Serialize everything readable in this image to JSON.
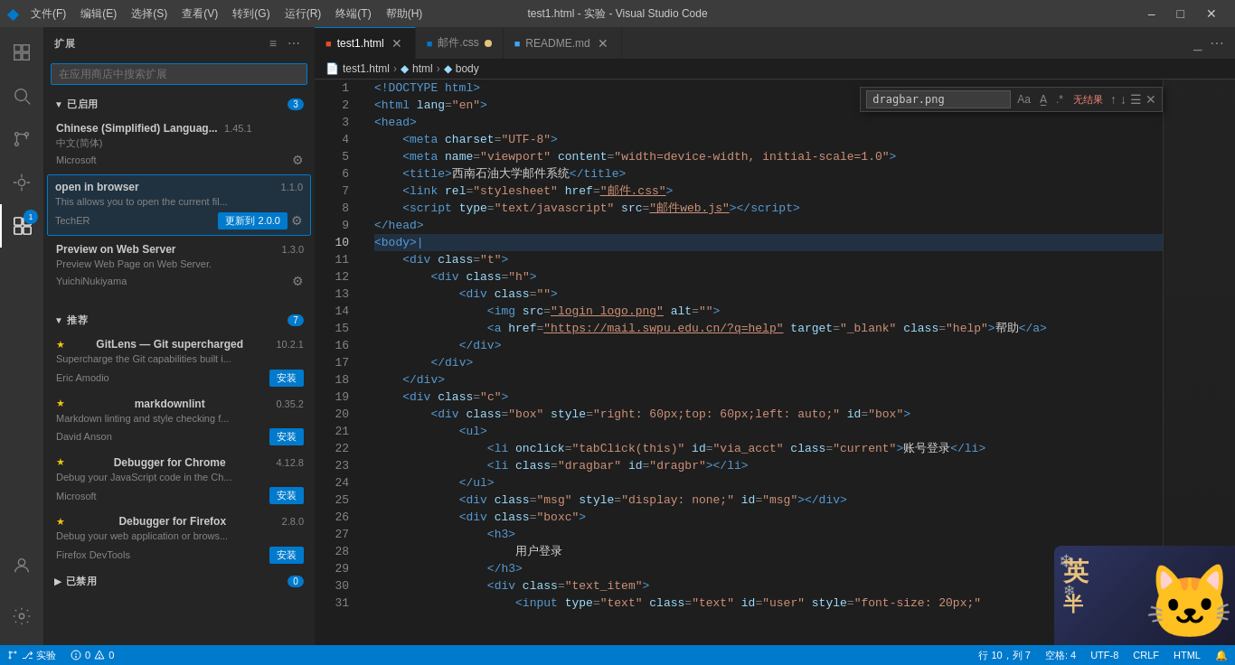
{
  "titleBar": {
    "icon": "VS",
    "menu": [
      "文件(F)",
      "编辑(E)",
      "选择(S)",
      "查看(V)",
      "转到(G)",
      "运行(R)",
      "终端(T)",
      "帮助(H)"
    ],
    "title": "test1.html - 实验 - Visual Studio Code",
    "controls": [
      "─",
      "□",
      "✕"
    ]
  },
  "activityBar": {
    "items": [
      {
        "icon": "⎇",
        "name": "source-control",
        "badge": "1"
      },
      {
        "icon": "🔍",
        "name": "search"
      },
      {
        "icon": "⎇",
        "name": "git"
      },
      {
        "icon": "🐛",
        "name": "debug"
      },
      {
        "icon": "⊞",
        "name": "extensions",
        "active": true
      }
    ]
  },
  "sidebar": {
    "title": "扩展",
    "searchPlaceholder": "在应用商店中搜索扩展",
    "sections": {
      "installed": {
        "label": "已启用",
        "badge": "3",
        "extensions": [
          {
            "name": "Chinese (Simplified) Languag...",
            "version": "1.45.1",
            "desc": "中文(简体)",
            "author": "Microsoft",
            "hasGear": true,
            "highlighted": false
          },
          {
            "name": "open in browser",
            "version": "1.1.0",
            "desc": "This allows you to open the current fil...",
            "author": "TechER",
            "hasUpdate": true,
            "updateLabel": "更新到 2.0.0",
            "hasGear": true,
            "highlighted": true
          },
          {
            "name": "Preview on Web Server",
            "version": "1.3.0",
            "desc": "Preview Web Page on Web Server.",
            "author": "YuichiNukiyama",
            "hasGear": true,
            "highlighted": false
          }
        ]
      },
      "recommended": {
        "label": "推荐",
        "badge": "7",
        "extensions": [
          {
            "name": "GitLens — Git supercharged",
            "version": "10.2.1",
            "desc": "Supercharge the Git capabilities built i...",
            "author": "Eric Amodio",
            "hasStar": true,
            "hasInstall": true,
            "installLabel": "安装"
          },
          {
            "name": "markdownlint",
            "version": "0.35.2",
            "desc": "Markdown linting and style checking f...",
            "author": "David Anson",
            "hasStar": true,
            "hasInstall": true,
            "installLabel": "安装"
          },
          {
            "name": "Debugger for Chrome",
            "version": "4.12.8",
            "desc": "Debug your JavaScript code in the Ch...",
            "author": "Microsoft",
            "hasStar": true,
            "hasInstall": true,
            "installLabel": "安装"
          },
          {
            "name": "Debugger for Firefox",
            "version": "2.8.0",
            "desc": "Debug your web application or brows...",
            "author": "Firefox DevTools",
            "hasStar": true,
            "hasInstall": true,
            "installLabel": "安装"
          }
        ]
      },
      "disabled": {
        "label": "已禁用",
        "badge": "0"
      }
    }
  },
  "tabs": [
    {
      "label": "test1.html",
      "active": true,
      "modified": false,
      "icon": "html"
    },
    {
      "label": "邮件.css",
      "active": false,
      "modified": true,
      "icon": "css"
    },
    {
      "label": "README.md",
      "active": false,
      "modified": false,
      "icon": "md"
    }
  ],
  "breadcrumb": [
    "test1.html",
    "html",
    "body"
  ],
  "searchBar": {
    "value": "dragbar.png",
    "noResults": "无结果"
  },
  "statusBar": {
    "git": "⎇ 实验",
    "errors": "⊗ 0",
    "warnings": "⚠ 0",
    "right": {
      "line": "行 10，列 7",
      "spaces": "空格: 4",
      "encoding": "UTF-8",
      "lineEnding": "CRLF",
      "lang": "HTML",
      "feedback": "🔔"
    }
  },
  "code": {
    "lines": [
      {
        "n": 1,
        "html": "<span class='c-doctype'>&lt;!DOCTYPE html&gt;</span>"
      },
      {
        "n": 2,
        "html": "<span class='c-tag'>&lt;html</span> <span class='c-attr'>lang</span><span class='c-punct'>=</span><span class='c-string'>\"en\"</span><span class='c-tag'>&gt;</span>"
      },
      {
        "n": 3,
        "html": "<span class='c-tag'>&lt;head&gt;</span>"
      },
      {
        "n": 4,
        "html": "    <span class='c-tag'>&lt;meta</span> <span class='c-attr'>charset</span><span class='c-punct'>=</span><span class='c-string'>\"UTF-8\"</span><span class='c-tag'>&gt;</span>"
      },
      {
        "n": 5,
        "html": "    <span class='c-tag'>&lt;meta</span> <span class='c-attr'>name</span><span class='c-punct'>=</span><span class='c-string'>\"viewport\"</span> <span class='c-attr'>content</span><span class='c-punct'>=</span><span class='c-string'>\"width=device-width, initial-scale=1.0\"</span><span class='c-tag'>&gt;</span>"
      },
      {
        "n": 6,
        "html": "    <span class='c-tag'>&lt;title&gt;</span><span class='c-text'>西南石油大学邮件系统</span><span class='c-tag'>&lt;/title&gt;</span>"
      },
      {
        "n": 7,
        "html": "    <span class='c-tag'>&lt;link</span> <span class='c-attr'>rel</span><span class='c-punct'>=</span><span class='c-string'>\"stylesheet\"</span> <span class='c-attr'>href</span><span class='c-punct'>=</span><span class='c-link'>\"邮件.css\"</span><span class='c-tag'>&gt;</span>"
      },
      {
        "n": 8,
        "html": "    <span class='c-tag'>&lt;script</span> <span class='c-attr'>type</span><span class='c-punct'>=</span><span class='c-string'>\"text/javascript\"</span> <span class='c-attr'>src</span><span class='c-punct'>=</span><span class='c-link'>\"邮件web.js\"</span><span class='c-tag'>&gt;&lt;/script&gt;</span>"
      },
      {
        "n": 9,
        "html": "<span class='c-tag'>&lt;/head&gt;</span>"
      },
      {
        "n": 10,
        "html": "<span class='c-tag'>&lt;body&gt;</span><span class='c-tag'>|</span>",
        "highlight": true
      },
      {
        "n": 11,
        "html": "    <span class='c-tag'>&lt;div</span> <span class='c-attr'>class</span><span class='c-punct'>=</span><span class='c-string'>\"t\"</span><span class='c-tag'>&gt;</span>"
      },
      {
        "n": 12,
        "html": "        <span class='c-tag'>&lt;div</span> <span class='c-attr'>class</span><span class='c-punct'>=</span><span class='c-string'>\"h\"</span><span class='c-tag'>&gt;</span>"
      },
      {
        "n": 13,
        "html": "            <span class='c-tag'>&lt;div</span> <span class='c-attr'>class</span><span class='c-punct'>=</span><span class='c-string'>\"\"</span><span class='c-tag'>&gt;</span>"
      },
      {
        "n": 14,
        "html": "                <span class='c-tag'>&lt;img</span> <span class='c-attr'>src</span><span class='c-punct'>=</span><span class='c-link'>\"login_logo.png\"</span> <span class='c-attr'>alt</span><span class='c-punct'>=</span><span class='c-string'>\"\"</span><span class='c-tag'>&gt;</span>"
      },
      {
        "n": 15,
        "html": "                <span class='c-tag'>&lt;a</span> <span class='c-attr'>href</span><span class='c-punct'>=</span><span class='c-link'>\"https://mail.swpu.edu.cn/?q=help\"</span> <span class='c-attr'>target</span><span class='c-punct'>=</span><span class='c-string'>\"_blank\"</span> <span class='c-attr'>class</span><span class='c-punct'>=</span><span class='c-string'>\"help\"</span><span class='c-tag'>&gt;</span><span class='c-text'>帮助</span><span class='c-tag'>&lt;/a&gt;</span>"
      },
      {
        "n": 16,
        "html": "            <span class='c-tag'>&lt;/div&gt;</span>"
      },
      {
        "n": 17,
        "html": "        <span class='c-tag'>&lt;/div&gt;</span>"
      },
      {
        "n": 18,
        "html": "    <span class='c-tag'>&lt;/div&gt;</span>"
      },
      {
        "n": 19,
        "html": "    <span class='c-tag'>&lt;div</span> <span class='c-attr'>class</span><span class='c-punct'>=</span><span class='c-string'>\"c\"</span><span class='c-tag'>&gt;</span>"
      },
      {
        "n": 20,
        "html": "        <span class='c-tag'>&lt;div</span> <span class='c-attr'>class</span><span class='c-punct'>=</span><span class='c-string'>\"box\"</span> <span class='c-attr'>style</span><span class='c-punct'>=</span><span class='c-string'>\"right: 60px;top: 60px;left: auto;\"</span> <span class='c-attr'>id</span><span class='c-punct'>=</span><span class='c-string'>\"box\"</span><span class='c-tag'>&gt;</span>"
      },
      {
        "n": 21,
        "html": "            <span class='c-tag'>&lt;ul&gt;</span>"
      },
      {
        "n": 22,
        "html": "                <span class='c-tag'>&lt;li</span> <span class='c-attr'>onclick</span><span class='c-punct'>=</span><span class='c-string'>\"tabClick(this)\"</span> <span class='c-attr'>id</span><span class='c-punct'>=</span><span class='c-string'>\"via_acct\"</span> <span class='c-attr'>class</span><span class='c-punct'>=</span><span class='c-string'>\"current\"</span><span class='c-tag'>&gt;</span><span class='c-text'>账号登录</span><span class='c-tag'>&lt;/li&gt;</span>"
      },
      {
        "n": 23,
        "html": "                <span class='c-tag'>&lt;li</span> <span class='c-attr'>class</span><span class='c-punct'>=</span><span class='c-string'>\"dragbar\"</span> <span class='c-attr'>id</span><span class='c-punct'>=</span><span class='c-string'>\"dragbr\"</span><span class='c-tag'>&gt;&lt;/li&gt;</span>"
      },
      {
        "n": 24,
        "html": "            <span class='c-tag'>&lt;/ul&gt;</span>"
      },
      {
        "n": 25,
        "html": "            <span class='c-tag'>&lt;div</span> <span class='c-attr'>class</span><span class='c-punct'>=</span><span class='c-string'>\"msg\"</span> <span class='c-attr'>style</span><span class='c-punct'>=</span><span class='c-string'>\"display: none;\"</span> <span class='c-attr'>id</span><span class='c-punct'>=</span><span class='c-string'>\"msg\"</span><span class='c-tag'>&gt;&lt;/div&gt;</span>"
      },
      {
        "n": 26,
        "html": "            <span class='c-tag'>&lt;div</span> <span class='c-attr'>class</span><span class='c-punct'>=</span><span class='c-string'>\"boxc\"</span><span class='c-tag'>&gt;</span>"
      },
      {
        "n": 27,
        "html": "                <span class='c-tag'>&lt;h3&gt;</span>"
      },
      {
        "n": 28,
        "html": "                    <span class='c-text'>用户登录</span>"
      },
      {
        "n": 29,
        "html": "                <span class='c-tag'>&lt;/h3&gt;</span>"
      },
      {
        "n": 30,
        "html": "                <span class='c-tag'>&lt;div</span> <span class='c-attr'>class</span><span class='c-punct'>=</span><span class='c-string'>\"text_item\"</span><span class='c-tag'>&gt;</span>"
      },
      {
        "n": 31,
        "html": "                    <span class='c-tag'>&lt;input</span> <span class='c-attr'>type</span><span class='c-punct'>=</span><span class='c-string'>\"text\"</span> <span class='c-attr'>class</span><span class='c-punct'>=</span><span class='c-string'>\"text\"</span> <span class='c-attr'>id</span><span class='c-punct'>=</span><span class='c-string'>\"user\"</span> <span class='c-attr'>style</span><span class='c-punct'>=</span><span class='c-string'>\"font-size: 20px;\"</span>"
      }
    ]
  },
  "decoration": {
    "textEn": "英",
    "textZh": "半",
    "char": "🐱"
  }
}
